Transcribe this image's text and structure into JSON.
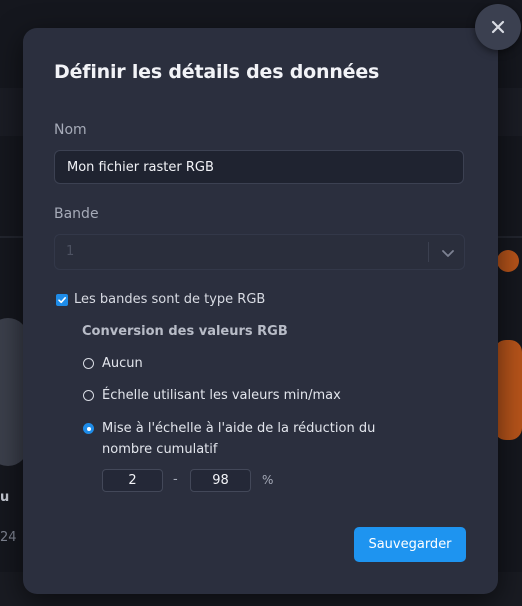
{
  "dialog": {
    "title": "Définir les détails des données",
    "name_label": "Nom",
    "name_value": "Mon fichier raster RGB",
    "band_label": "Bande",
    "band_value": "1",
    "rgb_checkbox_label": "Les bandes sont de type RGB",
    "rgb_checked": true,
    "conversion_title": "Conversion des valeurs RGB",
    "options": [
      {
        "label": "Aucun",
        "selected": false
      },
      {
        "label": "Échelle utilisant les valeurs min/max",
        "selected": false
      },
      {
        "label": "Mise à l'échelle à l'aide de la réduction du nombre cumulatif",
        "selected": true
      }
    ],
    "range_min": "2",
    "range_separator": "-",
    "range_max": "98",
    "range_unit": "%",
    "save_label": "Sauvegarder",
    "close_icon": "close-icon"
  },
  "background": {
    "partial_text_1": "u",
    "partial_text_2": "24"
  },
  "colors": {
    "modal_bg": "#2b2f3e",
    "accent": "#1e94f0",
    "backdrop": "#15171e"
  }
}
